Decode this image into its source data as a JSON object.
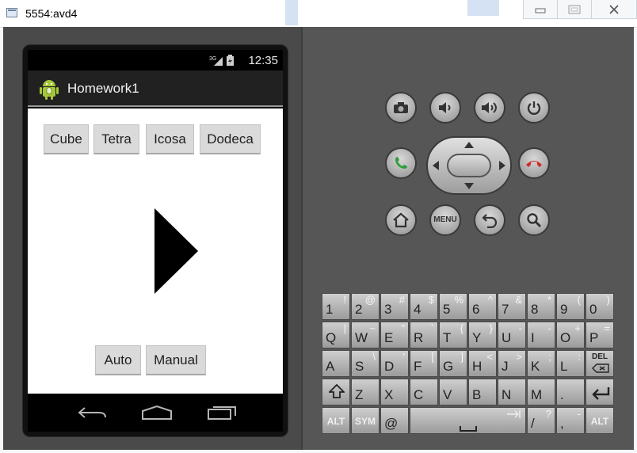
{
  "window": {
    "title": "5554:avd4"
  },
  "statusbar": {
    "network": "3G",
    "time": "12:35"
  },
  "app": {
    "title": "Homework1",
    "shape_buttons": [
      "Cube",
      "Tetra",
      "Icosa",
      "Dodeca"
    ],
    "mode_buttons": [
      "Auto",
      "Manual"
    ]
  },
  "controls": {
    "menu_label": "MENU"
  },
  "keyboard": {
    "rows": [
      [
        [
          "1",
          "!"
        ],
        [
          "2",
          "@"
        ],
        [
          "3",
          "#"
        ],
        [
          "4",
          "$"
        ],
        [
          "5",
          "%"
        ],
        [
          "6",
          "^"
        ],
        [
          "7",
          "&"
        ],
        [
          "8",
          "*"
        ],
        [
          "9",
          "("
        ],
        [
          "0",
          ")"
        ]
      ],
      [
        [
          "Q",
          "|"
        ],
        [
          "W",
          "~"
        ],
        [
          "E",
          "\""
        ],
        [
          "R",
          "`"
        ],
        [
          "T",
          "{"
        ],
        [
          "Y",
          "}"
        ],
        [
          "U",
          "-"
        ],
        [
          "I",
          "-"
        ],
        [
          "O",
          "+"
        ],
        [
          "P",
          "="
        ]
      ],
      [
        [
          "A",
          ""
        ],
        [
          "S",
          "\\"
        ],
        [
          "D",
          "'"
        ],
        [
          "F",
          "["
        ],
        [
          "G",
          "]"
        ],
        [
          "H",
          "<"
        ],
        [
          "J",
          ">"
        ],
        [
          "K",
          ";"
        ],
        [
          "L",
          ":"
        ]
      ],
      [
        [
          "Z",
          ""
        ],
        [
          "X",
          ""
        ],
        [
          "C",
          ""
        ],
        [
          "V",
          ""
        ],
        [
          "B",
          ""
        ],
        [
          "N",
          ""
        ],
        [
          "M",
          ""
        ],
        [
          ".",
          ""
        ]
      ],
      [
        [
          "@",
          ""
        ],
        [
          "/",
          "?"
        ],
        [
          ",",
          "-"
        ]
      ]
    ],
    "del_label": "DEL",
    "alt_label": "ALT",
    "sym_label": "SYM"
  }
}
